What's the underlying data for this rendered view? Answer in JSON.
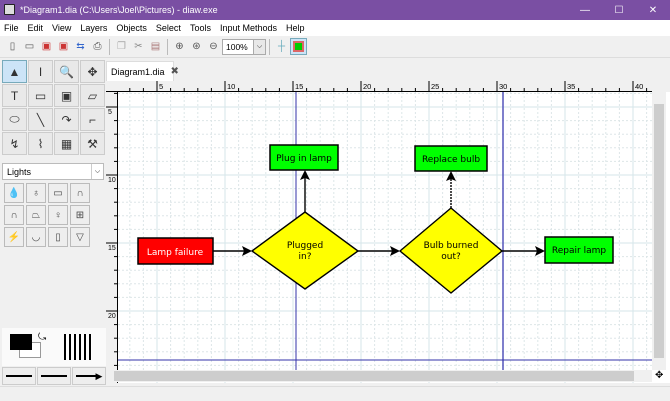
{
  "window": {
    "title": "*Diagram1.dia (C:\\Users\\Joel\\Pictures) - diaw.exe",
    "minimize": "—",
    "maximize": "☐",
    "close": "✕"
  },
  "menu": [
    "File",
    "Edit",
    "View",
    "Layers",
    "Objects",
    "Select",
    "Tools",
    "Input Methods",
    "Help"
  ],
  "toolbar": {
    "zoom_value": "100%",
    "icons": [
      "new-icon",
      "open-icon",
      "save-icon",
      "save-as-icon",
      "export-icon",
      "print-icon",
      "copy-icon",
      "cut-icon",
      "paste-icon",
      "zoom-in-icon",
      "zoom-fit-icon",
      "zoom-out-icon"
    ]
  },
  "toolbox": {
    "tools": [
      "▲",
      "I",
      "🔍",
      "✥",
      "T",
      "▭",
      "▣",
      "▱",
      "⬭",
      "╲",
      "↷",
      "⌐",
      "↯",
      "⌇",
      "▦",
      "⚒"
    ]
  },
  "sheet": {
    "selected": "Lights",
    "shapes": [
      "💧",
      "♁",
      "▭",
      "∩",
      "∩",
      "⏢",
      "♀",
      "⊞",
      "⚡",
      "◡",
      "▯",
      "▽"
    ]
  },
  "tab": {
    "label": "Diagram1.dia",
    "close": "✖"
  },
  "ruler": {
    "top": [
      "5",
      "10",
      "15",
      "20",
      "25",
      "30",
      "35",
      "40"
    ],
    "left": [
      "5",
      "10",
      "15",
      "20"
    ]
  },
  "diagram": {
    "nodes": {
      "plug": "Plug in lamp",
      "replace": "Replace bulb",
      "failure": "Lamp failure",
      "plugged1": "Plugged",
      "plugged2": "in?",
      "bulb1": "Bulb burned",
      "bulb2": "out?",
      "repair": "Repair lamp"
    },
    "colors": {
      "red": "#ff0000",
      "green": "#00ff00",
      "yellow": "#ffff00",
      "guide": "#3333aa"
    }
  }
}
